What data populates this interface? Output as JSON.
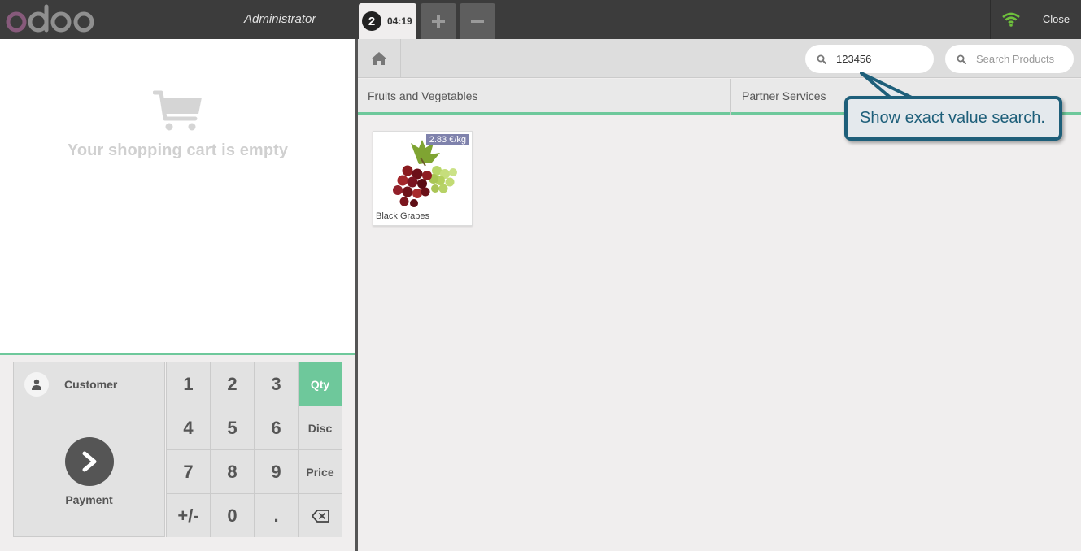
{
  "brand": {
    "logo_text": "odoo",
    "accent": "#875a7b"
  },
  "topbar": {
    "user": "Administrator",
    "order": {
      "number": "2",
      "time": "04:19"
    },
    "add_icon": "plus-icon",
    "remove_icon": "minus-icon",
    "wifi_icon": "wifi-icon",
    "close_label": "Close"
  },
  "cart": {
    "icon": "shopping-cart-icon",
    "empty_text": "Your shopping cart is empty"
  },
  "actionpad": {
    "customer_label": "Customer",
    "payment_label": "Payment"
  },
  "numpad": {
    "keys": [
      "1",
      "2",
      "3",
      "Qty",
      "4",
      "5",
      "6",
      "Disc",
      "7",
      "8",
      "9",
      "Price",
      "+/-",
      "0",
      "."
    ],
    "backspace_icon": "backspace-icon",
    "active_mode": "Qty"
  },
  "search": {
    "exact_value": "123456",
    "placeholder": "Search Products"
  },
  "categories": [
    "Fruits and Vegetables",
    "Partner Services"
  ],
  "products": [
    {
      "name": "Black Grapes",
      "price": "2.83 €/kg"
    }
  ],
  "tooltip": {
    "text": "Show exact value search."
  },
  "colors": {
    "topbar": "#3c3c3c",
    "green": "#6ec89b",
    "price_tag": "#7f82ac",
    "callout_border": "#1e5f7a"
  }
}
